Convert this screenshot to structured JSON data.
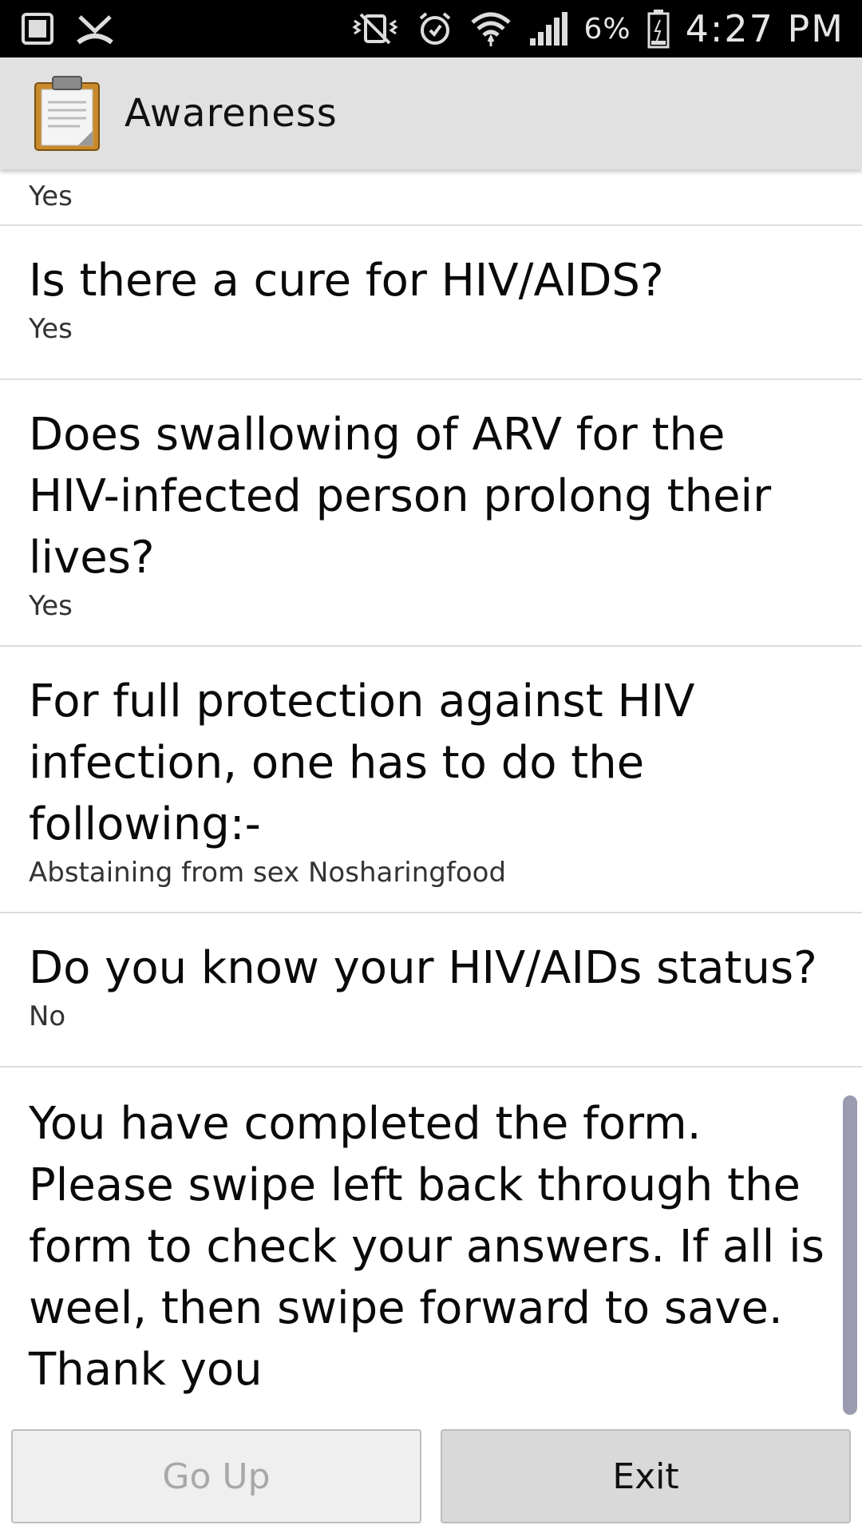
{
  "status_bar": {
    "battery": "6%",
    "time": "4:27 PM",
    "icons": [
      "picture-icon",
      "missed-call-icon",
      "vibrate-icon",
      "alarm-icon",
      "wifi-icon",
      "signal-icon",
      "battery-icon"
    ]
  },
  "action_bar": {
    "title": "Awareness",
    "icon": "clipboard-icon"
  },
  "form": {
    "partial_answer": "Yes",
    "items": [
      {
        "question": "Is there a cure for HIV/AIDS?",
        "answer": "Yes"
      },
      {
        "question": "Does swallowing of ARV for the HIV-infected person prolong their lives?",
        "answer": "Yes"
      },
      {
        "question": "For full protection against HIV infection, one has to do the following:-",
        "answer": "Abstaining from sex Nosharingfood"
      },
      {
        "question": "Do you know your HIV/AIDs status?",
        "answer": "No"
      }
    ],
    "completion_message": "You have completed the form. Please swipe left back through the form to check your answers. If all is weel, then swipe forward to save. Thank you"
  },
  "buttons": {
    "go_up": "Go Up",
    "exit": "Exit"
  },
  "colors": {
    "action_bar_bg": "#e1e1e1",
    "status_bar_bg": "#000000",
    "scrollbar": "#9a9bb0"
  }
}
